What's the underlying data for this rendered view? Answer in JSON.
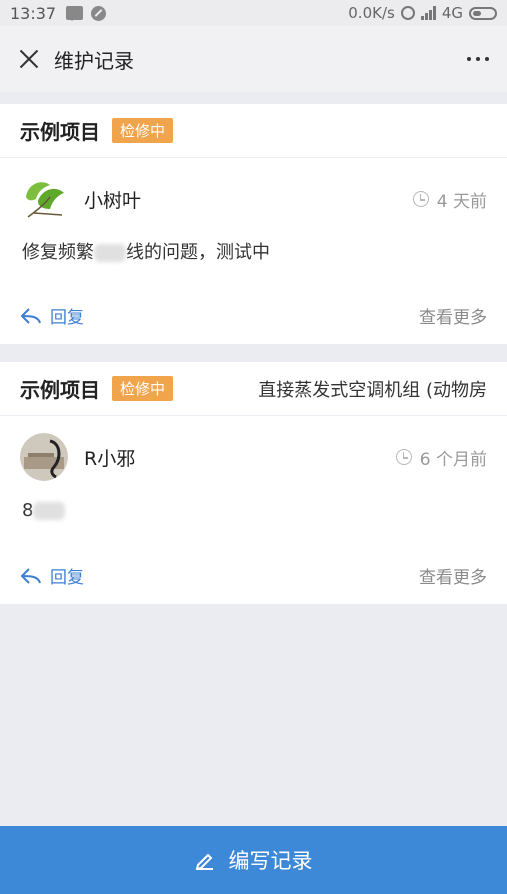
{
  "status_bar": {
    "time": "13:37",
    "speed": "0.0K/s",
    "network": "4G"
  },
  "header": {
    "title": "维护记录"
  },
  "records": [
    {
      "project": "示例项目",
      "status": "检修中",
      "equipment": "",
      "user": "小树叶",
      "time": "4 天前",
      "content_before": "修复频繁",
      "content_after": "线的问题，测试中",
      "reply_label": "回复",
      "more_label": "查看更多"
    },
    {
      "project": "示例项目",
      "status": "检修中",
      "equipment": "直接蒸发式空调机组 (动物房",
      "user": "R小邪",
      "time": "6 个月前",
      "content_before": "8",
      "content_after": "",
      "reply_label": "回复",
      "more_label": "查看更多"
    }
  ],
  "bottom_button": {
    "label": "编写记录"
  },
  "colors": {
    "accent": "#3e88d8",
    "badge": "#f0a44c",
    "link": "#3d7fd2"
  }
}
